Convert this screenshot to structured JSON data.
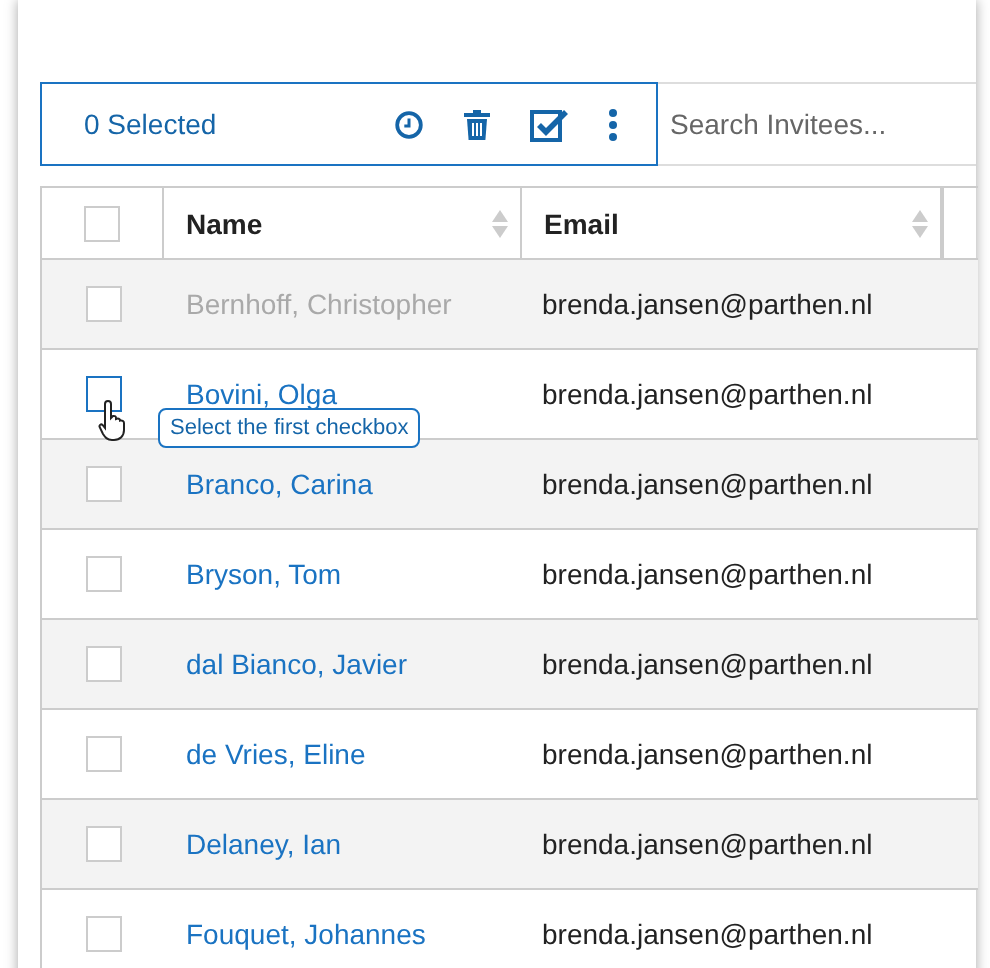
{
  "toolbar": {
    "selected_count": "0 Selected",
    "search": {
      "placeholder": "Search Invitees..."
    }
  },
  "table": {
    "select_all": {
      "checked": false
    },
    "columns": [
      {
        "label": "Name",
        "sortable": true
      },
      {
        "label": "Email",
        "sortable": true
      }
    ],
    "rows": [
      {
        "name": "Bernhoff, Christopher",
        "email": "brenda.jansen@parthen.nl",
        "disabled": true,
        "checked": false
      },
      {
        "name": "Bovini, Olga",
        "email": "brenda.jansen@parthen.nl",
        "disabled": false,
        "checked": false,
        "tooltip": "Select the first checkbox"
      },
      {
        "name": "Branco, Carina",
        "email": "brenda.jansen@parthen.nl",
        "disabled": false,
        "checked": false
      },
      {
        "name": "Bryson, Tom",
        "email": "brenda.jansen@parthen.nl",
        "disabled": false,
        "checked": false
      },
      {
        "name": "dal Bianco, Javier",
        "email": "brenda.jansen@parthen.nl",
        "disabled": false,
        "checked": false
      },
      {
        "name": "de Vries, Eline",
        "email": "brenda.jansen@parthen.nl",
        "disabled": false,
        "checked": false
      },
      {
        "name": "Delaney, Ian",
        "email": "brenda.jansen@parthen.nl",
        "disabled": false,
        "checked": false
      },
      {
        "name": "Fouquet, Johannes",
        "email": "brenda.jansen@parthen.nl",
        "disabled": false,
        "checked": false
      }
    ]
  }
}
